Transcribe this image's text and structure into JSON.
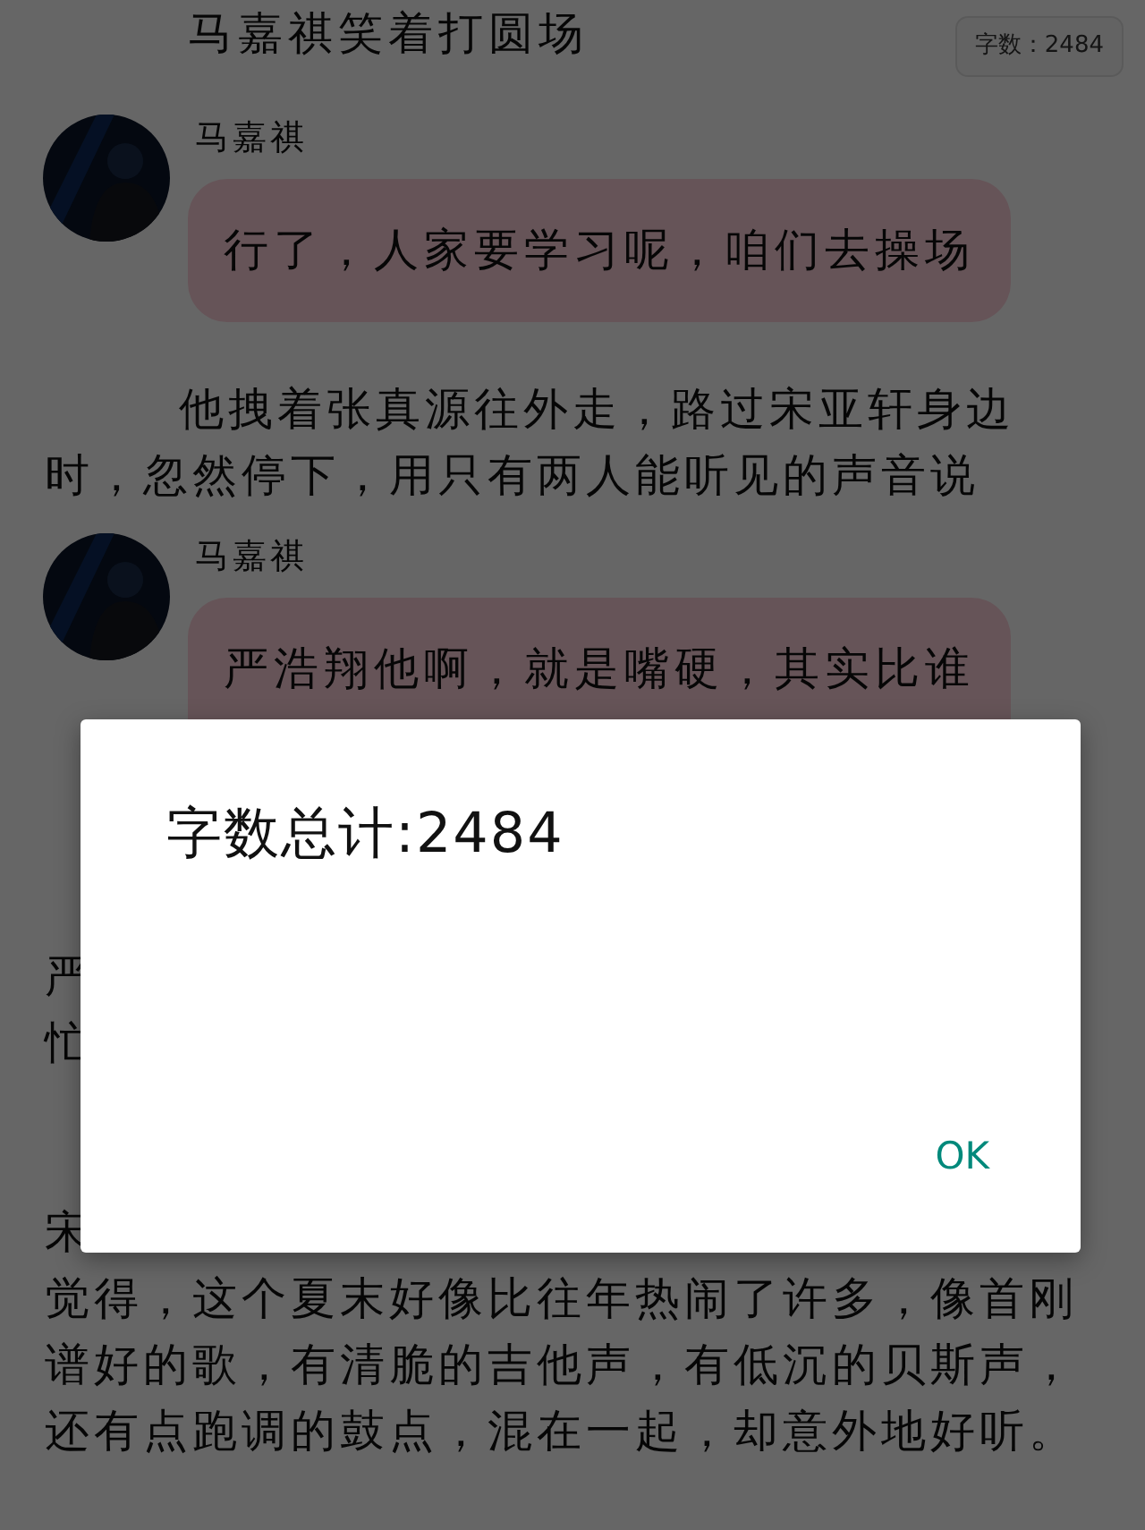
{
  "header": {
    "title": "马嘉祺笑着打圆场",
    "word_count_badge": "字数：2484"
  },
  "story": [
    {
      "kind": "message",
      "sender": "马嘉祺",
      "text": "行了，人家要学习呢，咱们去操场"
    },
    {
      "kind": "paragraph",
      "indented": true,
      "lines": [
        "他拽着张真源往外走，路过宋亚轩身边",
        "时，忽然停下，用只有两人能听见的声音说"
      ]
    },
    {
      "kind": "message",
      "sender": "马嘉祺",
      "text": "严浩翔他啊，就是嘴硬，其实比谁"
    },
    {
      "kind": "paragraph",
      "indented": false,
      "lines": [
        "严",
        "忙"
      ]
    },
    {
      "kind": "paragraph",
      "indented": false,
      "lines": [
        "宋",
        "觉得，这个夏末好像比往年热闹了许多，像首刚",
        "谱好的歌，有清脆的吉他声，有低沉的贝斯声，",
        "还有点跑调的鼓点，混在一起，却意外地好听。"
      ]
    }
  ],
  "dialog": {
    "message": "字数总计:2484",
    "button": "OK"
  }
}
